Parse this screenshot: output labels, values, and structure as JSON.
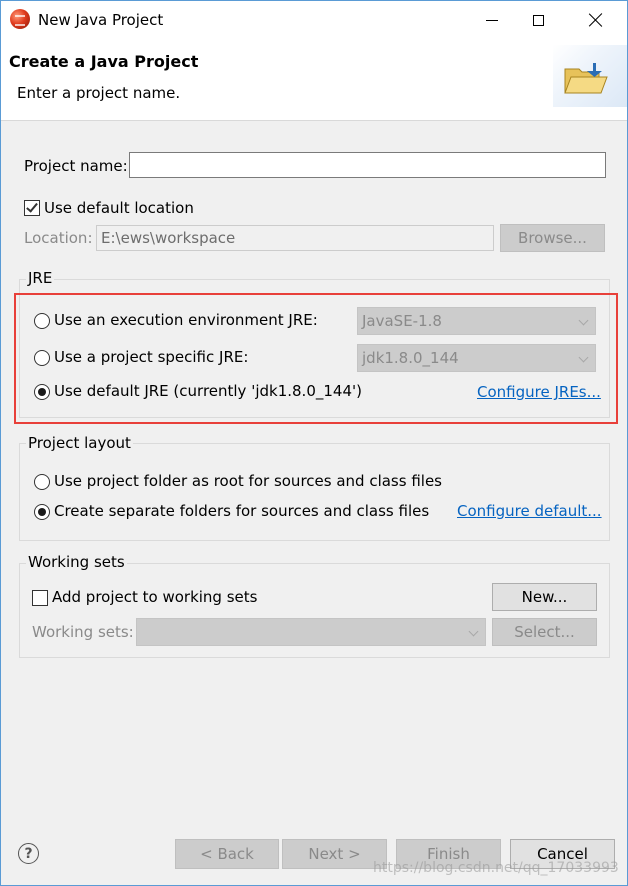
{
  "window": {
    "title": "New Java Project"
  },
  "banner": {
    "title": "Create a Java Project",
    "description": "Enter a project name."
  },
  "project": {
    "name_label": "Project name:",
    "name_value": "",
    "use_default_location_label": "Use default location",
    "use_default_location_checked": true,
    "location_label": "Location:",
    "location_value": "E:\\ews\\workspace",
    "browse_label": "Browse..."
  },
  "jre": {
    "group_title": "JRE",
    "options": [
      {
        "label": "Use an execution environment JRE:",
        "selected": false,
        "combo_value": "JavaSE-1.8"
      },
      {
        "label": "Use a project specific JRE:",
        "selected": false,
        "combo_value": "jdk1.8.0_144"
      },
      {
        "label": "Use default JRE (currently 'jdk1.8.0_144')",
        "selected": true
      }
    ],
    "configure_link": "Configure JREs..."
  },
  "layout": {
    "group_title": "Project layout",
    "options": [
      {
        "label": "Use project folder as root for sources and class files",
        "selected": false
      },
      {
        "label": "Create separate folders for sources and class files",
        "selected": true
      }
    ],
    "configure_link": "Configure default..."
  },
  "working_sets": {
    "group_title": "Working sets",
    "add_label": "Add project to working sets",
    "add_checked": false,
    "new_label": "New...",
    "sets_label": "Working sets:",
    "sets_value": "",
    "select_label": "Select..."
  },
  "footer": {
    "back_label": "< Back",
    "next_label": "Next >",
    "finish_label": "Finish",
    "cancel_label": "Cancel",
    "watermark": "https://blog.csdn.net/qq_17033993"
  },
  "colors": {
    "highlight_box": "#e8403a",
    "link": "#0563c1"
  }
}
